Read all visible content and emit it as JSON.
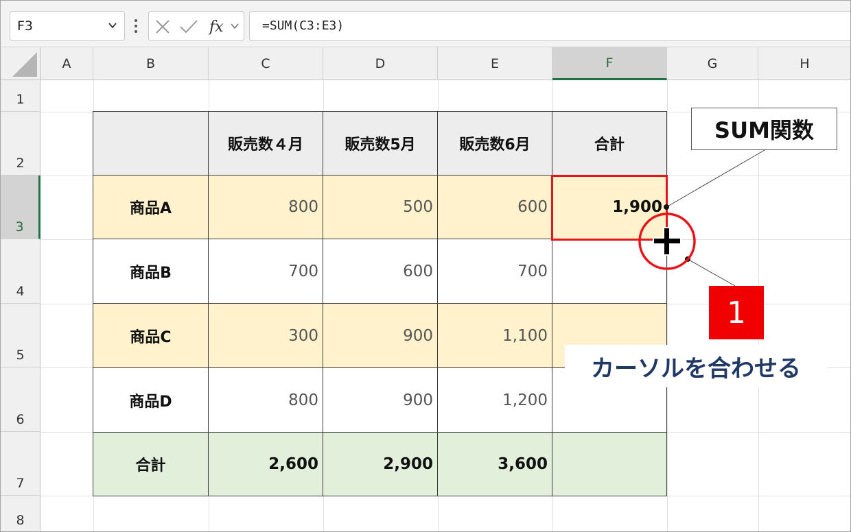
{
  "formula_bar": {
    "name_box": "F3",
    "formula": "=SUM(C3:E3)",
    "fx_icon": "fx-icon",
    "cancel_icon": "x-icon",
    "enter_icon": "check-icon"
  },
  "columns": [
    "A",
    "B",
    "C",
    "D",
    "E",
    "F",
    "G",
    "H"
  ],
  "rows": [
    "1",
    "2",
    "3",
    "4",
    "5",
    "6",
    "7",
    "8"
  ],
  "selected": {
    "column": "F",
    "row": "3"
  },
  "table": {
    "header": [
      "",
      "販売数４月",
      "販売数5月",
      "販売数6月",
      "合計"
    ],
    "rows": [
      {
        "label": "商品A",
        "values": [
          "800",
          "500",
          "600",
          "1,900"
        ]
      },
      {
        "label": "商品B",
        "values": [
          "700",
          "600",
          "700",
          ""
        ]
      },
      {
        "label": "商品C",
        "values": [
          "300",
          "900",
          "1,100",
          ""
        ]
      },
      {
        "label": "商品D",
        "values": [
          "800",
          "900",
          "1,200",
          ""
        ]
      },
      {
        "label": "合計",
        "values": [
          "2,600",
          "2,900",
          "3,600",
          ""
        ]
      }
    ]
  },
  "annotations": {
    "callout": "SUM関数",
    "step_number": "1",
    "hint": "カーソルを合わせる"
  },
  "colors": {
    "accent_red": "#e8141a",
    "row_yellow": "#fff2cc",
    "row_green": "#e2efda",
    "hint_blue": "#1f3864",
    "excel_green": "#217346"
  }
}
